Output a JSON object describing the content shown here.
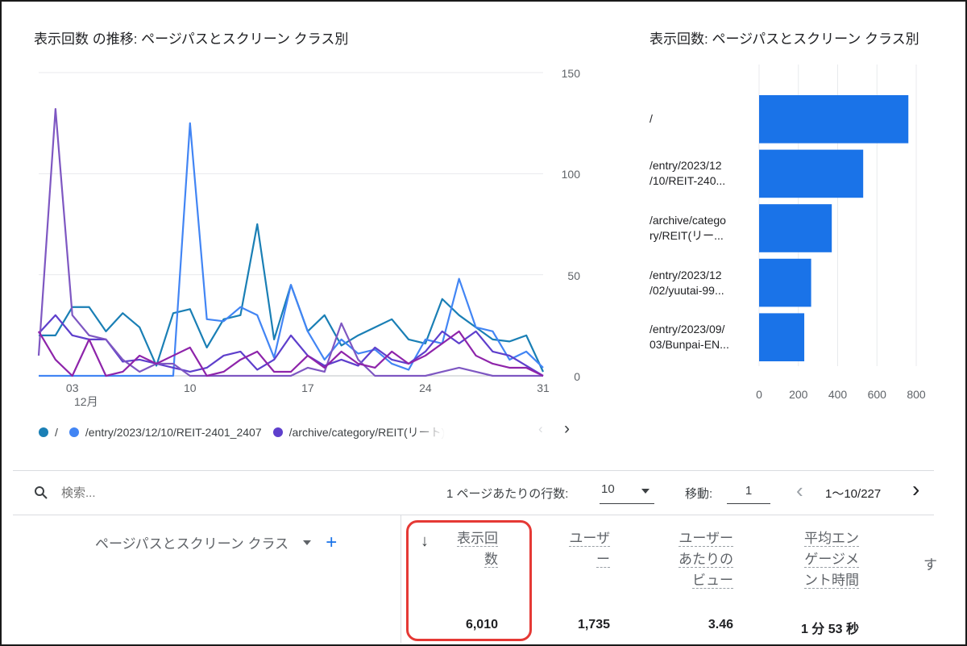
{
  "line_chart": {
    "title": "表示回数 の推移: ページパスとスクリーン クラス別",
    "chart_data": {
      "type": "line",
      "title": "表示回数 の推移: ページパスとスクリーン クラス別",
      "x_tick_labels": [
        "03",
        "10",
        "17",
        "24",
        "31"
      ],
      "x_sublabel": "12月",
      "y_tick_labels": [
        "150",
        "100",
        "50",
        "0"
      ],
      "ylim": [
        0,
        150
      ],
      "x": [
        1,
        2,
        3,
        4,
        5,
        6,
        7,
        8,
        9,
        10,
        11,
        12,
        13,
        14,
        15,
        16,
        17,
        18,
        19,
        20,
        21,
        22,
        23,
        24,
        25,
        26,
        27,
        28,
        29,
        30,
        31
      ],
      "series": [
        {
          "name": "/",
          "color": "#1a7fb5",
          "values": [
            20,
            20,
            34,
            34,
            22,
            31,
            24,
            5,
            31,
            33,
            14,
            28,
            30,
            75,
            18,
            45,
            22,
            30,
            15,
            20,
            24,
            28,
            18,
            16,
            38,
            30,
            24,
            18,
            17,
            20,
            2
          ]
        },
        {
          "name": "/entry/2023/12/10/REIT-2401_2407",
          "color": "#4285f4",
          "values": [
            0,
            0,
            0,
            0,
            0,
            0,
            0,
            0,
            0,
            125,
            28,
            27,
            34,
            30,
            9,
            45,
            22,
            8,
            18,
            11,
            13,
            6,
            3,
            18,
            16,
            48,
            24,
            22,
            8,
            12,
            4
          ]
        },
        {
          "name": "/archive/category/REIT(リート)",
          "color": "#5e3fcc",
          "values": [
            21,
            30,
            20,
            18,
            18,
            7,
            8,
            6,
            4,
            2,
            4,
            10,
            12,
            3,
            8,
            20,
            10,
            5,
            8,
            5,
            14,
            8,
            6,
            12,
            22,
            16,
            22,
            12,
            10,
            5,
            0
          ]
        },
        {
          "name": "",
          "color": "#7e57c2",
          "values": [
            10,
            132,
            30,
            20,
            18,
            8,
            2,
            6,
            6,
            0,
            0,
            0,
            0,
            0,
            0,
            0,
            4,
            2,
            26,
            8,
            0,
            0,
            0,
            0,
            2,
            4,
            2,
            0,
            0,
            0,
            0
          ]
        },
        {
          "name": "",
          "color": "#8e24aa",
          "values": [
            22,
            8,
            0,
            18,
            0,
            2,
            10,
            6,
            10,
            14,
            0,
            2,
            8,
            12,
            2,
            2,
            10,
            4,
            12,
            6,
            4,
            12,
            6,
            10,
            16,
            22,
            10,
            6,
            4,
            4,
            0
          ]
        }
      ]
    },
    "legend_more": "›"
  },
  "bar_chart": {
    "title": "表示回数: ページパスとスクリーン クラス別",
    "chart_data": {
      "type": "bar",
      "orientation": "horizontal",
      "categories": [
        "/",
        "/entry/2023/12/10/REIT-240...",
        "/archive/category/REIT(リー...",
        "/entry/2023/12/02/yuutai-99...",
        "/entry/2023/09/03/Bunpai-EN..."
      ],
      "category_display": [
        [
          "/"
        ],
        [
          "/entry/2023/12",
          "/10/REIT-240..."
        ],
        [
          "/archive/catego",
          "ry/REIT(リー..."
        ],
        [
          "/entry/2023/12",
          "/02/yuutai-99..."
        ],
        [
          "/entry/2023/09/",
          "03/Bunpai-EN..."
        ]
      ],
      "values": [
        760,
        530,
        370,
        265,
        230
      ],
      "xlim": [
        0,
        800
      ],
      "x_tick_labels": [
        "0",
        "200",
        "400",
        "600",
        "800"
      ],
      "color": "#1a73e8"
    }
  },
  "toolbar": {
    "search_placeholder": "検索...",
    "rows_per_page_label": "1 ページあたりの行数:",
    "rows_per_page_value": "10",
    "goto_label": "移動:",
    "goto_value": "1",
    "pagination_text": "1〜10/227"
  },
  "table": {
    "dimension_header": "ページパスとスクリーン クラス",
    "columns": [
      {
        "label_lines": [
          "表示回",
          "数"
        ],
        "total": "6,010",
        "sorted": true
      },
      {
        "label_lines": [
          "ユーザ",
          "ー"
        ],
        "total": "1,735"
      },
      {
        "label_lines": [
          "ユーザー",
          "あたりの",
          "ビュー"
        ],
        "total": "3.46"
      },
      {
        "label_lines": [
          "平均エン",
          "ゲージメ",
          "ント時間"
        ],
        "total": "1 分 53 秒"
      }
    ],
    "cut_header": "す"
  },
  "colors": {
    "highlight_box": "#e53935",
    "accent_blue": "#1a73e8"
  }
}
